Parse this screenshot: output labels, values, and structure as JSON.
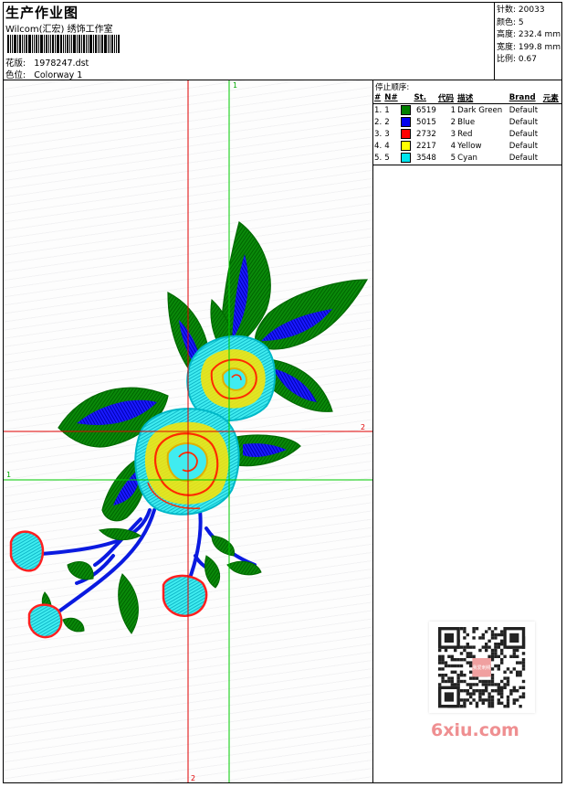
{
  "header": {
    "title": "生产作业图",
    "subtitle": "Wilcom(汇宏) 绣饰工作室",
    "design_label": "花版:",
    "design_value": "1978247.dst",
    "colorway_label": "色位:",
    "colorway_value": "Colorway 1"
  },
  "stats": [
    {
      "label": "针数:",
      "value": "20033"
    },
    {
      "label": "颜色:",
      "value": "5"
    },
    {
      "label": "高度:",
      "value": "232.4 mm"
    },
    {
      "label": "宽度:",
      "value": "199.8 mm"
    },
    {
      "label": "比例:",
      "value": "0.67"
    }
  ],
  "stop_list": {
    "title": "停止顺序:",
    "columns": [
      "#",
      "N#",
      "St.",
      "代码",
      "描述",
      "Brand",
      "元素"
    ],
    "rows": [
      {
        "idx": "1.",
        "n": "1",
        "color": "#008000",
        "st": "6519",
        "code": "1",
        "desc": "Dark Green",
        "brand": "Default"
      },
      {
        "idx": "2.",
        "n": "2",
        "color": "#0000ee",
        "st": "5015",
        "code": "2",
        "desc": "Blue",
        "brand": "Default"
      },
      {
        "idx": "3.",
        "n": "3",
        "color": "#ff0000",
        "st": "2732",
        "code": "3",
        "desc": "Red",
        "brand": "Default"
      },
      {
        "idx": "4.",
        "n": "4",
        "color": "#ffff00",
        "st": "2217",
        "code": "4",
        "desc": "Yellow",
        "brand": "Default"
      },
      {
        "idx": "5.",
        "n": "5",
        "color": "#00e5ee",
        "st": "3548",
        "code": "5",
        "desc": "Cyan",
        "brand": "Default"
      }
    ]
  },
  "guides": {
    "v1_label": "1",
    "h1_label": "1",
    "v2_label": "2",
    "h2_label": "2"
  },
  "colors": {
    "dark_green": "#008000",
    "blue": "#0000ee",
    "red": "#ff0000",
    "yellow": "#ffff00",
    "cyan": "#00e5ee",
    "guide_red": "#e00000",
    "guide_green": "#00cc00"
  },
  "watermark": {
    "qr_center_text": "我爱刺绣",
    "text": "6xiu.com"
  }
}
